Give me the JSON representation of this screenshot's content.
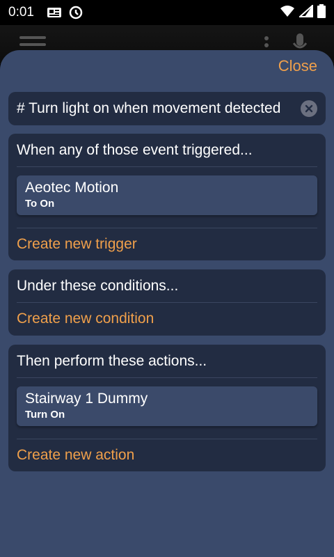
{
  "status_bar": {
    "time": "0:01"
  },
  "sheet": {
    "close_label": "Close",
    "automation_name": "# Turn light on when movement detected",
    "trigger_section": {
      "title": "When any of those event triggered...",
      "items": [
        {
          "name": "Aeotec Motion",
          "state": "To On"
        }
      ],
      "create_label": "Create new trigger"
    },
    "condition_section": {
      "title": "Under these conditions...",
      "create_label": "Create new condition"
    },
    "action_section": {
      "title": "Then perform these actions...",
      "items": [
        {
          "name": "Stairway 1 Dummy",
          "state": "Turn On"
        }
      ],
      "create_label": "Create new action"
    }
  },
  "colors": {
    "accent": "#f0a04b",
    "sheet_bg": "#3a4a6b",
    "card_bg": "#222c42",
    "item_bg": "#3b4a6a"
  }
}
